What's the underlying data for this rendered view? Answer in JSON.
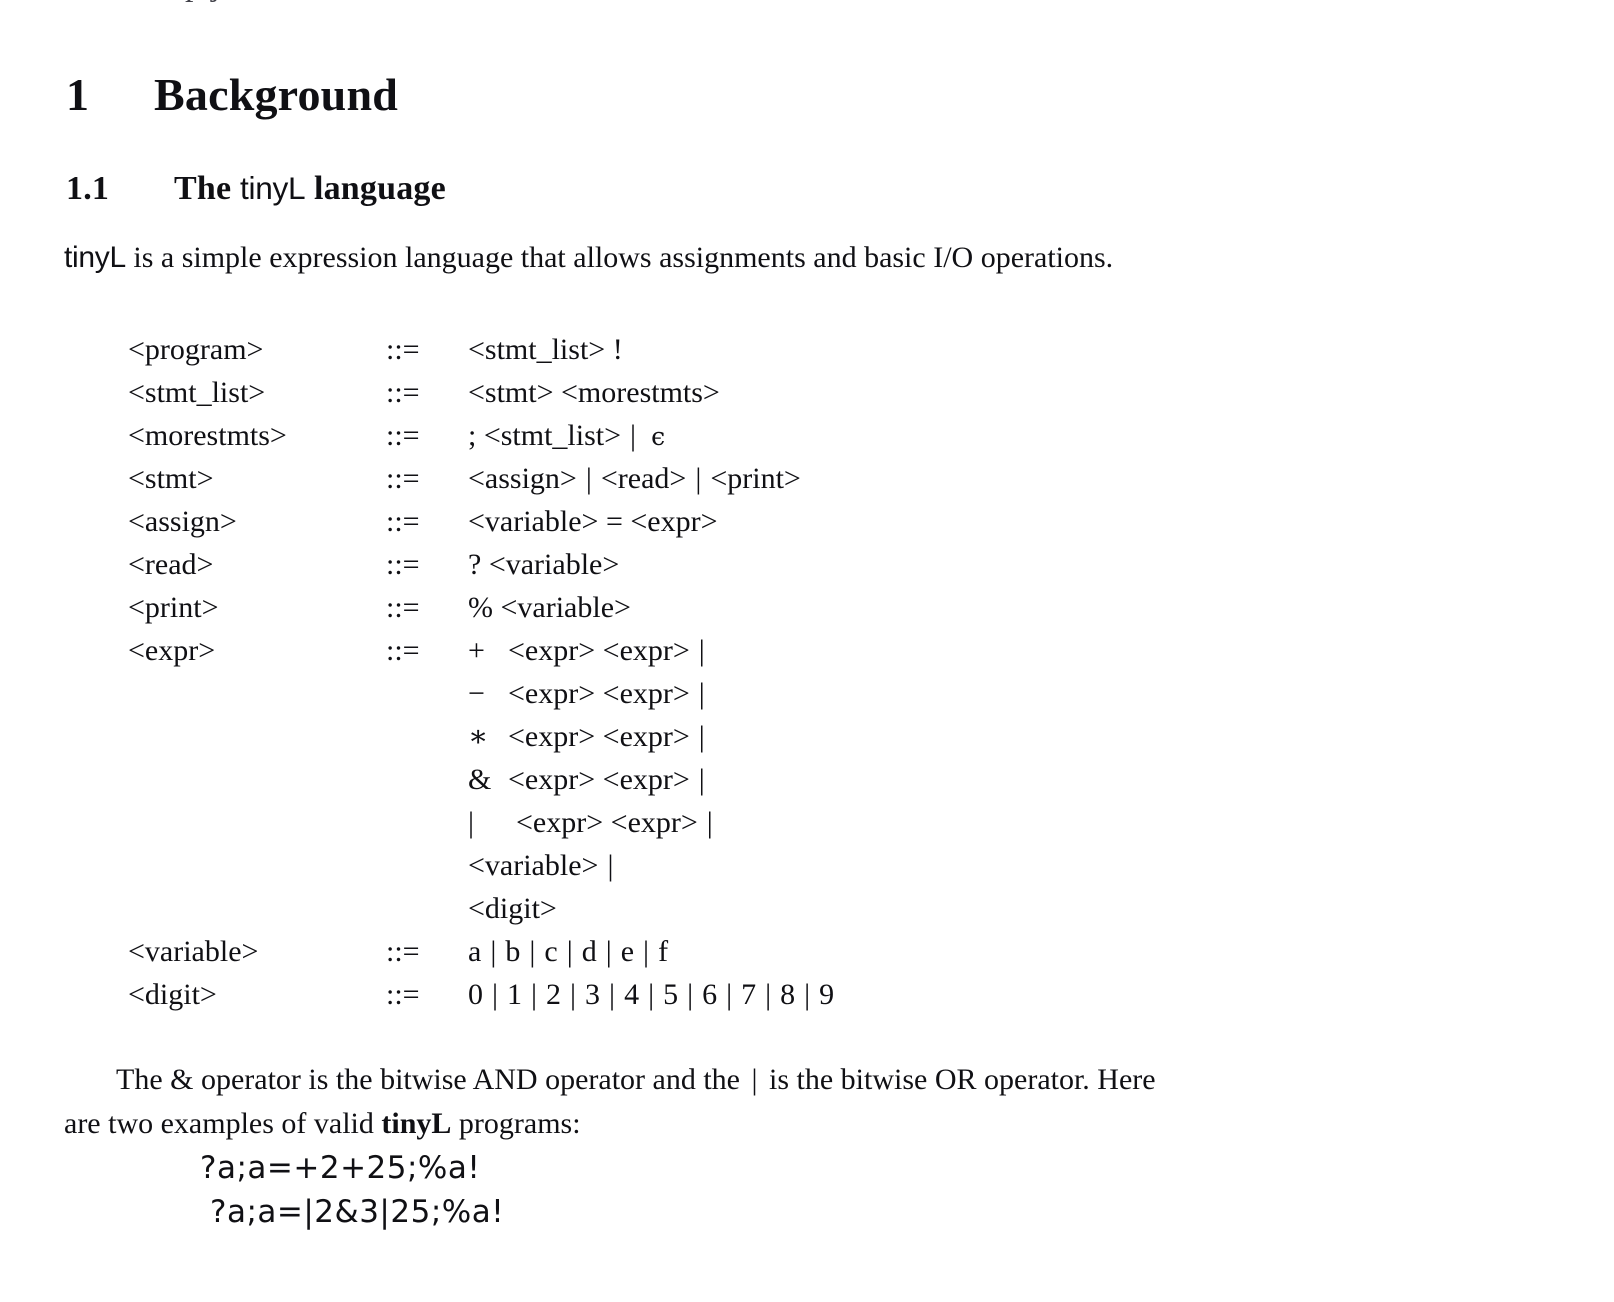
{
  "document": {
    "top_cutoff_fragment": "p                                        j",
    "section": {
      "number": "1",
      "title": "Background"
    },
    "subsection": {
      "number": "1.1",
      "title_prefix": "The ",
      "title_mono": "tinyL",
      "title_suffix": " language"
    },
    "intro": {
      "lang_name": "tinyL",
      "text": " is a simple expression language that allows assignments and basic I/O operations."
    },
    "grammar": {
      "operator": "::=",
      "rules": [
        {
          "lhs": "<program>",
          "rhs_plain": "<stmt_list> !"
        },
        {
          "lhs": "<stmt_list>",
          "rhs_plain": "<stmt> <morestmts>"
        },
        {
          "lhs": "<morestmts>",
          "rhs_plain": "; <stmt_list>",
          "bar": "|",
          "epsilon": "ϵ"
        },
        {
          "lhs": "<stmt>",
          "alternatives": [
            "<assign>",
            "<read>",
            "<print>"
          ],
          "bar": "|"
        },
        {
          "lhs": "<assign>",
          "rhs_plain": "<variable> = <expr>"
        },
        {
          "lhs": "<read>",
          "rhs_plain": "? <variable>"
        },
        {
          "lhs": "<print>",
          "rhs_plain": "% <variable>"
        }
      ],
      "expr_rule": {
        "lhs": "<expr>",
        "productions": [
          {
            "op": "+",
            "operands": "<expr> <expr>",
            "bar": "|"
          },
          {
            "op": "−",
            "operands": "<expr> <expr>",
            "bar": "|"
          },
          {
            "op": "∗",
            "operands": "<expr> <expr>",
            "bar": "|"
          },
          {
            "op": "&",
            "operands": "<expr> <expr>",
            "bar": "|"
          },
          {
            "op": "|",
            "operands": "<expr> <expr>",
            "bar": "|"
          },
          {
            "op": "",
            "operands": "<variable>",
            "bar": "|"
          },
          {
            "op": "",
            "operands": "<digit>",
            "bar": ""
          }
        ]
      },
      "terminal_rules": [
        {
          "lhs": "<variable>",
          "values": [
            "a",
            "b",
            "c",
            "d",
            "e",
            "f"
          ],
          "bar": "|"
        },
        {
          "lhs": "<digit>",
          "values": [
            "0",
            "1",
            "2",
            "3",
            "4",
            "5",
            "6",
            "7",
            "8",
            "9"
          ],
          "bar": "|"
        }
      ]
    },
    "closing": {
      "line1_a": "The & operator is the bitwise AND operator and the ",
      "line1_pipe": "|",
      "line1_b": " is the bitwise OR operator.  Here",
      "line2_a": "are two examples of valid ",
      "line2_bold": "tinyL",
      "line2_b": " programs:"
    },
    "examples": [
      "?a;a=+2+25;%a!",
      "?a;a=|2&3|25;%a!"
    ]
  }
}
